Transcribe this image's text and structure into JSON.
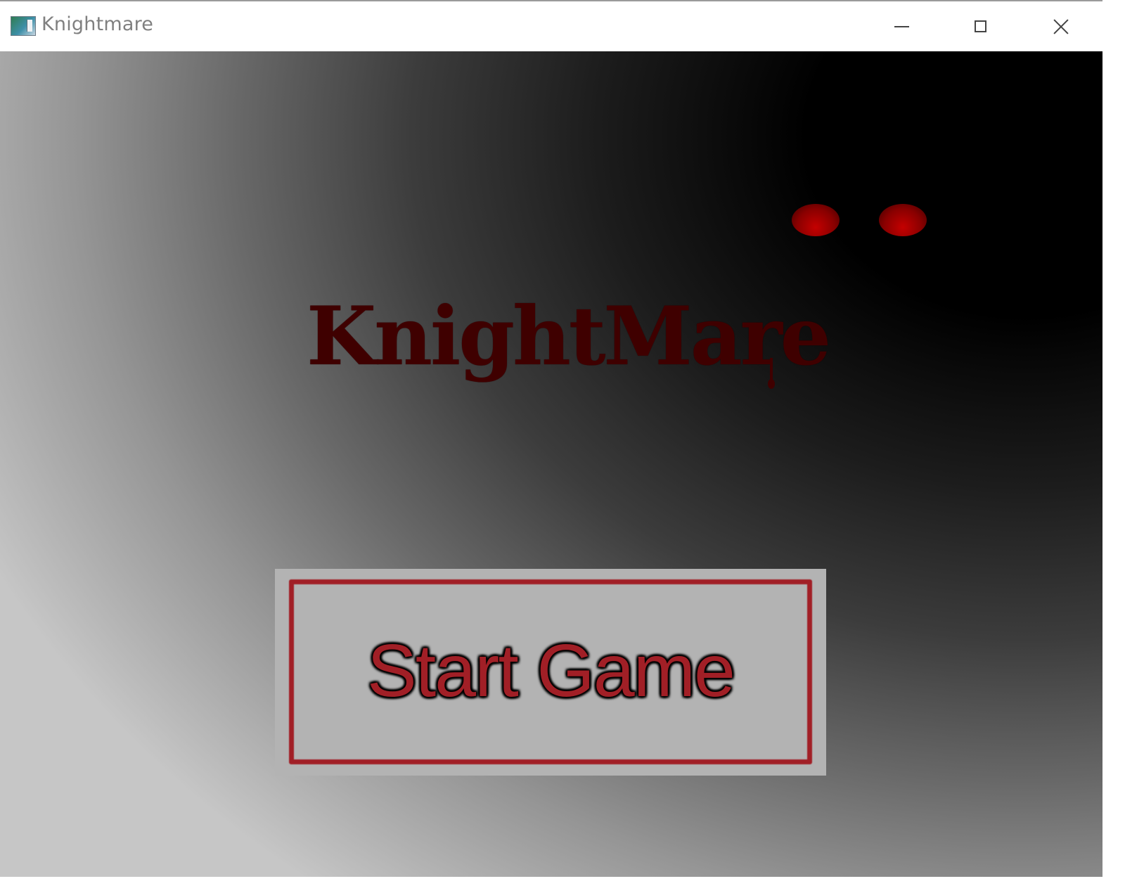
{
  "window": {
    "title": "Knightmare",
    "icon": "app-icon",
    "controls": {
      "minimize": "minimize-icon",
      "maximize": "maximize-icon",
      "close": "close-icon"
    }
  },
  "game": {
    "logo_text": "KnightMare",
    "start_button_label": "Start Game",
    "colors": {
      "logo": "#3f0000",
      "eyes": "#b00000",
      "button_text": "#a11f26",
      "button_border": "#a11f26",
      "button_background": "#b3b3b3",
      "background_dark": "#000000",
      "background_light": "#c6c6c6"
    }
  }
}
